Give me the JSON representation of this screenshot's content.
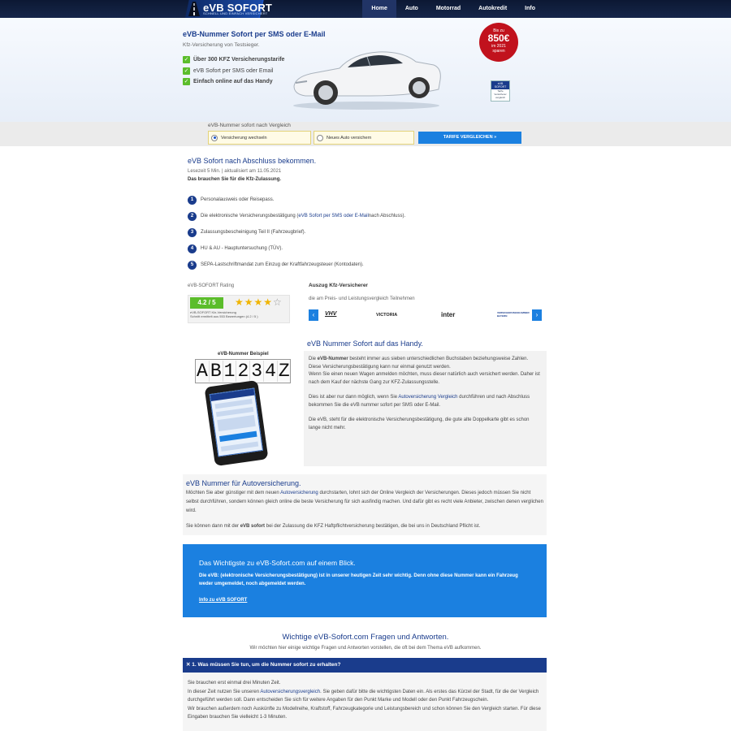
{
  "brand": {
    "name": "eVB SOFORT",
    "tagline": "SCHNELL UND EINFACH VERSICHERT"
  },
  "nav": {
    "items": [
      "Home",
      "Auto",
      "Motorrad",
      "Autokredit",
      "Info"
    ],
    "active": "Home"
  },
  "hero": {
    "title": "eVB-Nummer Sofort per SMS oder E-Mail",
    "subtitle": "Kfz-Versicherung von Testsieger.",
    "bullets": [
      {
        "bold": "Über 300 KFZ Versicherungstarife",
        "rest": ""
      },
      {
        "bold": "",
        "rest": "eVB Sofort per SMS oder Email"
      },
      {
        "bold": "Einfach online auf das Handy",
        "rest": ""
      }
    ],
    "badge": {
      "line1": "Bis zu",
      "amount": "850€",
      "line2": "im 2021",
      "line3": "sparen"
    },
    "seal": {
      "top": "eVB SOFORT",
      "text": "Tarife Versicherer vergleich"
    }
  },
  "compare": {
    "label": "eVB-Nummer sofort nach Vergleich",
    "option1": "Versicherung wechseln",
    "option2": "Neues Auto versichern",
    "button": "TARIFE VERGLEICHEN »"
  },
  "article": {
    "title": "eVB Sofort nach Abschluss bekommen.",
    "meta": "Lesezeit 5 Min. | aktualisiert am 11.05.2021",
    "intro": "Das brauchen Sie für die Kfz-Zulassung.",
    "steps": [
      {
        "n": "1",
        "pre": "Personalausweis oder Reisepass.",
        "link": "",
        "post": ""
      },
      {
        "n": "2",
        "pre": "Die elektronische Versicherungsbestätigung (",
        "link": "eVB Sofort per SMS oder E-Mail",
        "post": " nach Abschluss)."
      },
      {
        "n": "3",
        "pre": "Zulassungsbescheinigung Teil II (Fahrzeugbrief).",
        "link": "",
        "post": ""
      },
      {
        "n": "4",
        "pre": "HU & AU - Hauptuntersuchung (TÜV).",
        "link": "",
        "post": ""
      },
      {
        "n": "5",
        "pre": "SEPA-Lastschriftmandat zum Einzug der Kraftfahrzeugsteuer (Kontodaten).",
        "link": "",
        "post": ""
      }
    ]
  },
  "rating": {
    "title": "eVB-SOFORT Rating",
    "score": "4.2 / 5",
    "stars_value": 4.2,
    "note1": "eVB-SOFORT Kfz-Versicherung",
    "note2": "Schnitt ermittelt aus 553 Bewertungen (4.2 / 5 )"
  },
  "insurers": {
    "title": "Auszug Kfz-Versicherer",
    "subtitle": "die am Preis- und Leistungsvergleich Teilnehmen",
    "logos": [
      "VHV",
      "VICTORIA",
      "inter",
      "VERSICHERUNGSKAMMER BAYERN"
    ]
  },
  "handy": {
    "title": "eVB Nummer Sofort auf das Handy.",
    "example_label": "eVB-Nummer Beispiel",
    "plate": [
      "A",
      "B",
      "1",
      "2",
      "3",
      "4",
      "Z"
    ],
    "p1_pre": "Die ",
    "p1_bold": "eVB-Nummer",
    "p1_post": " besteht immer aus sieben unterschiedlichen Buchstaben beziehungsweise Zahlen. Diese Versicherungsbestätigung kann nur einmal genutzt werden.",
    "p1b": "Wenn Sie einen neuen Wagen anmelden möchten, muss dieser natürlich auch versichert werden. Daher ist nach dem Kauf der nächste Gang zur KFZ-Zulassungsstelle.",
    "p2_pre": "Dies ist aber nur dann möglich, wenn Sie ",
    "p2_link": "Autoversicherung Vergleich",
    "p2_post": " durchführen und nach Abschluss bekommen Sie die eVB nummer sofort per SMS oder E-Mail.",
    "p3": "Die eVB, steht für die elektronische Versicherungsbestätigung, die gute alte Doppelkarte gibt es schon lange nicht mehr."
  },
  "av": {
    "title": "eVB Nummer für Autoversicherung.",
    "p1_pre": "Möchten Sie aber günstiger mit dem neuen ",
    "p1_link": "Autoversicherung",
    "p1_post": " durchstarten, lohnt sich der Online Vergleich der Versicherungen. Dieses jedoch müssen Sie nicht selbst durchführen, sondern können gleich online die beste Versicherung für sich ausfindig machen. Und dafür gibt es recht viele Anbieter, zwischen denen verglichen wird.",
    "p2_pre": "Sie können dann mit der ",
    "p2_bold": "eVB sofort",
    "p2_post": " bei der Zulassung die KFZ Haftpflichtversicherung bestätigen, die bei uns in Deutschland Pflicht ist."
  },
  "info": {
    "title": "Das Wichtigste zu eVB-Sofort.com auf einem Blick.",
    "text": "Die eVB: (elektronische Versicherungsbestätigung) ist in unserer heutigen Zeit sehr wichtig. Denn ohne diese Nummer kann ein Fahrzeug weder umgemeldet, noch abgemeldet werden.",
    "link": "Info zu eVB SOFORT"
  },
  "faq": {
    "title": "Wichtige eVB-Sofort.com Fragen und Antworten.",
    "subtitle": "Wir möchten hier einige wichtige Fragen und Antworten vorstellen, die oft bei dem Thema eVB aufkommen.",
    "q1": "✕  1. Was müssen Sie tun, um die Nummer sofort zu erhalten?",
    "a1_l1": "Sie brauchen erst einmal drei Minuten Zeit.",
    "a1_l2_pre": "In dieser Zeit nutzen Sie unseren ",
    "a1_l2_link": "Autoversicherungsvergleich",
    "a1_l2_post": ". Sie geben dafür bitte die wichtigsten Daten ein. Als erstes das Kürzel der Stadt, für die der Vergleich durchgeführt werden soll. Dann entscheiden Sie sich für weitere Angaben für den Punkt Marke und Modell oder den Punkt Fahrzeugschein.",
    "a1_l3": "Wir brauchen außerdem noch Auskünfte zu Modellreihe, Kraftstoff, Fahrzeugkategorie und Leistungsbereich und schon können Sie den Vergleich starten. Für diese Eingaben brauchen Sie vielleicht 1-3 Minuten."
  }
}
